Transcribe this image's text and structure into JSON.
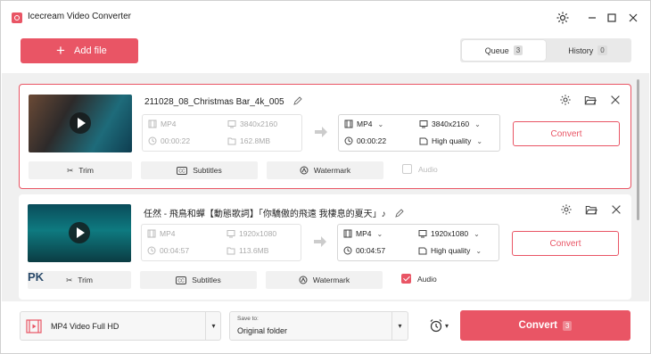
{
  "app": {
    "title": "Icecream Video Converter",
    "accent": "#e95565"
  },
  "toolbar": {
    "add_file_label": "Add file"
  },
  "tabs": [
    {
      "label": "Queue",
      "count": "3",
      "active": true
    },
    {
      "label": "History",
      "count": "0",
      "active": false
    }
  ],
  "items": [
    {
      "filename": "211028_08_Christmas Bar_4k_005",
      "source": {
        "format": "MP4",
        "resolution": "3840x2160",
        "duration": "00:00:22",
        "size": "162.8MB"
      },
      "target": {
        "format": "MP4",
        "resolution": "3840x2160",
        "duration": "00:00:22",
        "quality": "High quality"
      },
      "convert_label": "Convert",
      "actions": {
        "trim": "Trim",
        "subtitles": "Subtitles",
        "watermark": "Watermark",
        "audio": "Audio"
      },
      "audio_checked": false,
      "selected": true
    },
    {
      "filename": "任然 - 飛鳥和蟬【動態歌詞】「你驕傲的飛遠 我棲息的夏天」♪",
      "source": {
        "format": "MP4",
        "resolution": "1920x1080",
        "duration": "00:04:57",
        "size": "113.6MB"
      },
      "target": {
        "format": "MP4",
        "resolution": "1920x1080",
        "duration": "00:04:57",
        "quality": "High quality"
      },
      "convert_label": "Convert",
      "actions": {
        "trim": "Trim",
        "subtitles": "Subtitles",
        "watermark": "Watermark",
        "audio": "Audio"
      },
      "audio_checked": true,
      "selected": false,
      "watermark_logo": "PK"
    }
  ],
  "bottom": {
    "format_label": "MP4 Video Full HD",
    "save_to_label": "Save to:",
    "save_to_value": "Original folder",
    "convert_label": "Convert",
    "convert_count": "3"
  }
}
